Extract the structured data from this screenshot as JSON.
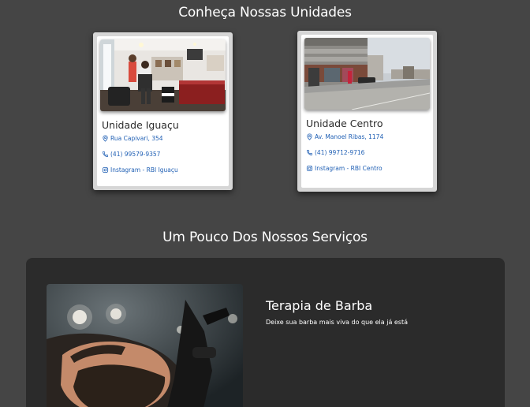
{
  "units_section": {
    "title": "Conheça Nossas Unidades",
    "units": [
      {
        "name": "Unidade Iguaçu",
        "address": "Rua Capivari, 354",
        "phone": "(41) 99579-9357",
        "instagram": "Instagram - RBI Iguaçu",
        "photo_icon": "barbershop-interior-photo"
      },
      {
        "name": "Unidade Centro",
        "address": "Av. Manoel Ribas, 1174",
        "phone": "(41) 99712-9716",
        "instagram": "Instagram - RBI Centro",
        "photo_icon": "storefront-street-photo"
      }
    ],
    "icons": {
      "address": "map-pin-icon",
      "phone": "phone-icon",
      "instagram": "instagram-icon"
    }
  },
  "services_section": {
    "title": "Um Pouco Dos Nossos Serviços",
    "services": [
      {
        "name": "Terapia de Barba",
        "description": "Deixe sua barba mais viva do que ela já está",
        "photo_icon": "beard-therapy-photo"
      }
    ]
  },
  "colors": {
    "page_background": "#454545",
    "services_box": "#2b2b2b",
    "link_blue": "#1f5fb4",
    "card_frame": "#d6d6d6"
  }
}
